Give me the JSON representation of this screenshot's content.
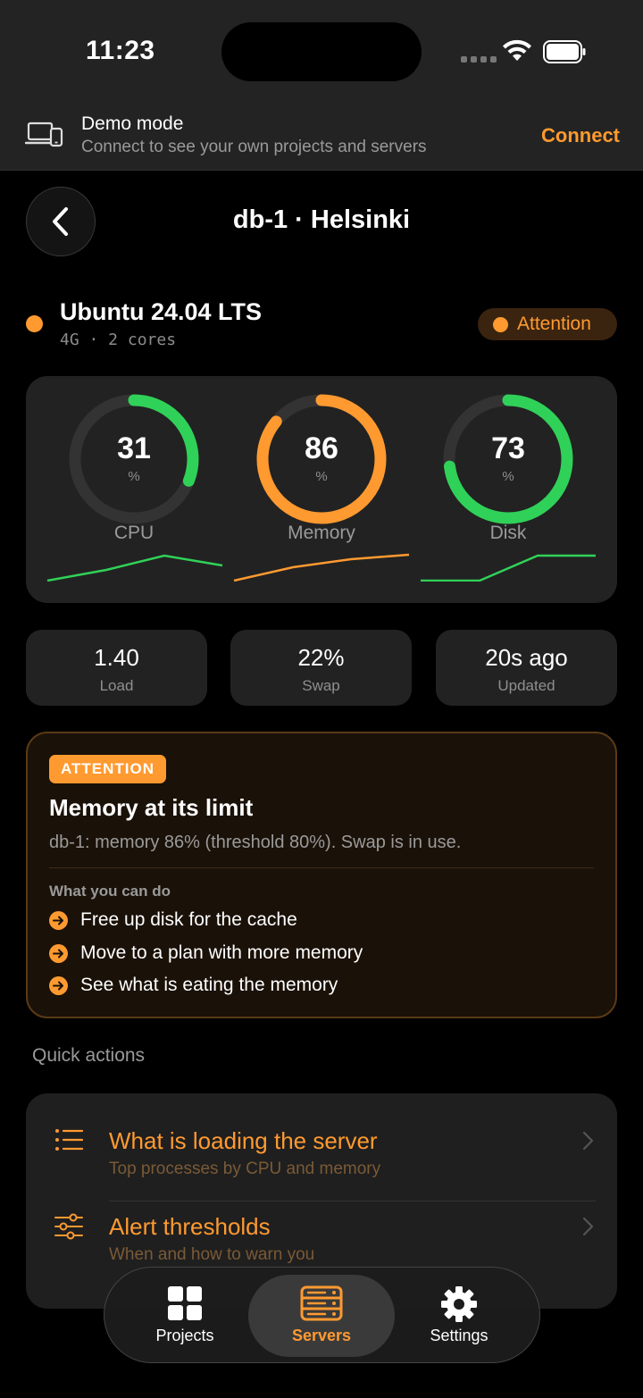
{
  "status_bar": {
    "time": "11:23"
  },
  "demo_banner": {
    "title": "Demo mode",
    "subtitle": "Connect to see your own projects and servers",
    "action": "Connect"
  },
  "header": {
    "title": "db-1 · Helsinki"
  },
  "server": {
    "os": "Ubuntu 24.04 LTS",
    "specs": "4G · 2 cores",
    "status": "Attention"
  },
  "gauges": [
    {
      "value": "31",
      "unit": "%",
      "label": "CPU",
      "fraction": 0.31,
      "color": "#30d158"
    },
    {
      "value": "86",
      "unit": "%",
      "label": "Memory",
      "fraction": 0.86,
      "color": "#ff9a30"
    },
    {
      "value": "73",
      "unit": "%",
      "label": "Disk",
      "fraction": 0.73,
      "color": "#30d158"
    }
  ],
  "stats": [
    {
      "value": "1.40",
      "label": "Load"
    },
    {
      "value": "22%",
      "label": "Swap"
    },
    {
      "value": "20s ago",
      "label": "Updated"
    }
  ],
  "attention": {
    "badge": "ATTENTION",
    "title": "Memory at its limit",
    "description": "db-1: memory 86% (threshold 80%). Swap is in use.",
    "subheading": "What you can do",
    "items": [
      "Free up disk for the cache",
      "Move to a plan with more memory",
      "See what is eating the memory"
    ]
  },
  "quick_actions": {
    "heading": "Quick actions",
    "items": [
      {
        "title": "What is loading the server",
        "subtitle": "Top processes by CPU and memory",
        "icon": "list-icon"
      },
      {
        "title": "Alert thresholds",
        "subtitle": "When and how to warn you",
        "icon": "sliders-icon"
      }
    ]
  },
  "tabs": [
    {
      "label": "Projects",
      "icon": "grid-icon",
      "active": false
    },
    {
      "label": "Servers",
      "icon": "server-icon",
      "active": true
    },
    {
      "label": "Settings",
      "icon": "gear-icon",
      "active": false
    }
  ],
  "colors": {
    "accent": "#ff9a30",
    "ok": "#30d158"
  }
}
